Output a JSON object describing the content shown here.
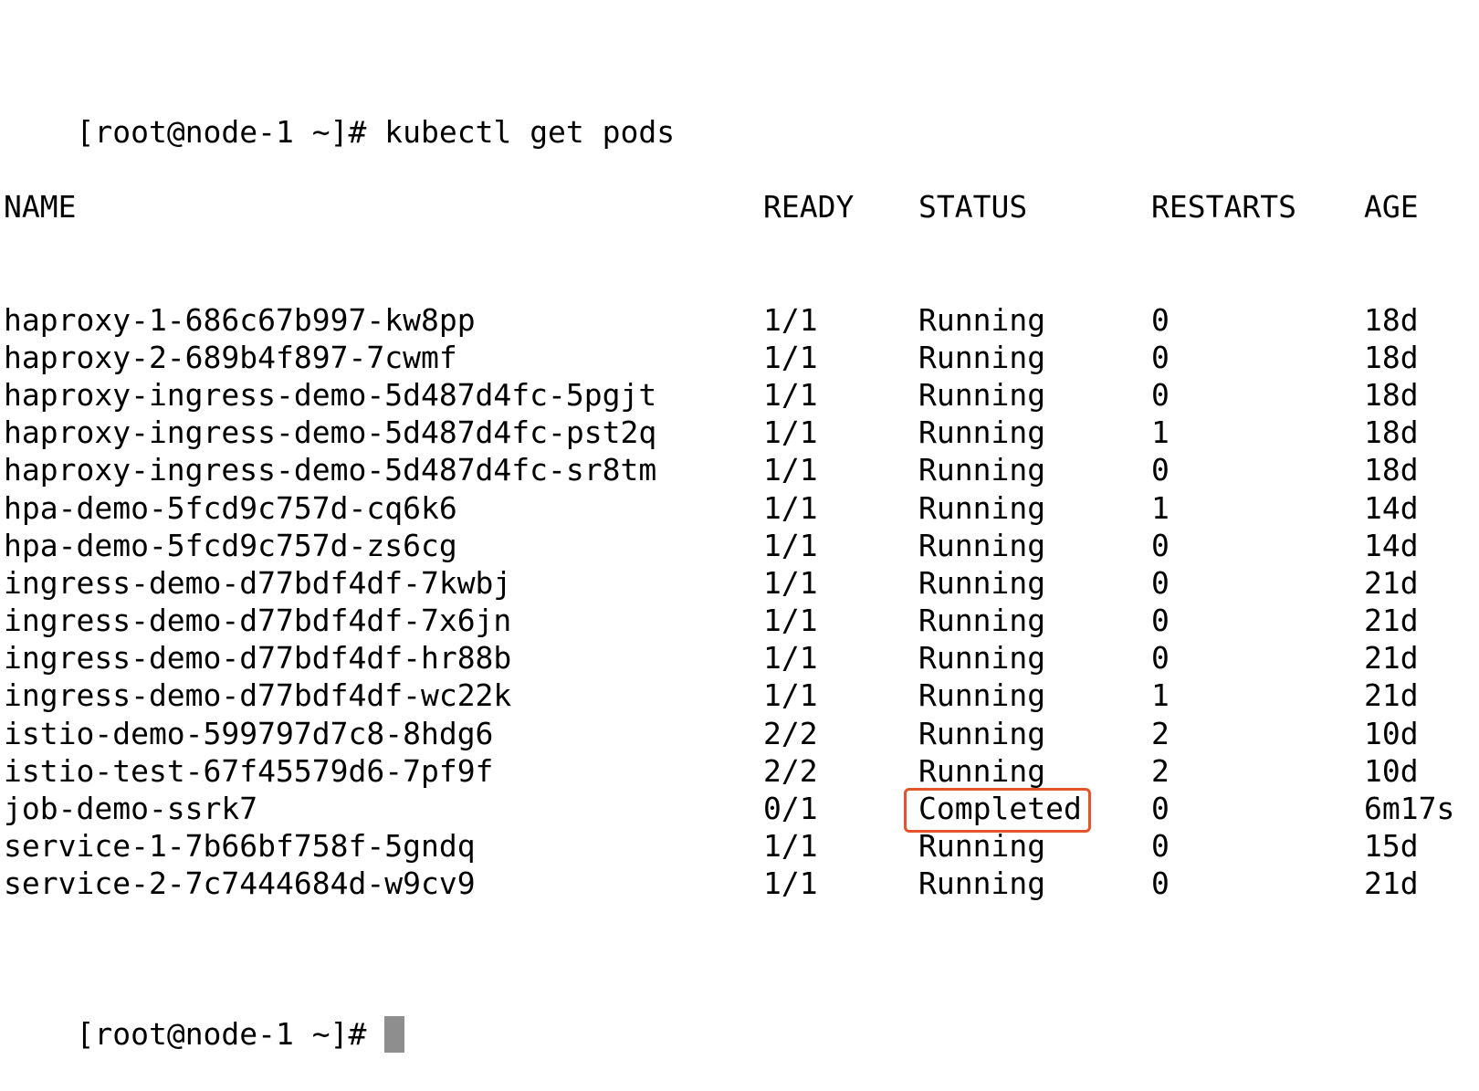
{
  "prompt": "[root@node-1 ~]# ",
  "command": "kubectl get pods",
  "headers": {
    "name": "NAME",
    "ready": "READY",
    "status": "STATUS",
    "restarts": "RESTARTS",
    "age": "AGE"
  },
  "rows": [
    {
      "name": "haproxy-1-686c67b997-kw8pp",
      "ready": "1/1",
      "status": "Running",
      "restarts": "0",
      "age": "18d"
    },
    {
      "name": "haproxy-2-689b4f897-7cwmf",
      "ready": "1/1",
      "status": "Running",
      "restarts": "0",
      "age": "18d"
    },
    {
      "name": "haproxy-ingress-demo-5d487d4fc-5pgjt",
      "ready": "1/1",
      "status": "Running",
      "restarts": "0",
      "age": "18d"
    },
    {
      "name": "haproxy-ingress-demo-5d487d4fc-pst2q",
      "ready": "1/1",
      "status": "Running",
      "restarts": "1",
      "age": "18d"
    },
    {
      "name": "haproxy-ingress-demo-5d487d4fc-sr8tm",
      "ready": "1/1",
      "status": "Running",
      "restarts": "0",
      "age": "18d"
    },
    {
      "name": "hpa-demo-5fcd9c757d-cq6k6",
      "ready": "1/1",
      "status": "Running",
      "restarts": "1",
      "age": "14d"
    },
    {
      "name": "hpa-demo-5fcd9c757d-zs6cg",
      "ready": "1/1",
      "status": "Running",
      "restarts": "0",
      "age": "14d"
    },
    {
      "name": "ingress-demo-d77bdf4df-7kwbj",
      "ready": "1/1",
      "status": "Running",
      "restarts": "0",
      "age": "21d"
    },
    {
      "name": "ingress-demo-d77bdf4df-7x6jn",
      "ready": "1/1",
      "status": "Running",
      "restarts": "0",
      "age": "21d"
    },
    {
      "name": "ingress-demo-d77bdf4df-hr88b",
      "ready": "1/1",
      "status": "Running",
      "restarts": "0",
      "age": "21d"
    },
    {
      "name": "ingress-demo-d77bdf4df-wc22k",
      "ready": "1/1",
      "status": "Running",
      "restarts": "1",
      "age": "21d"
    },
    {
      "name": "istio-demo-599797d7c8-8hdg6",
      "ready": "2/2",
      "status": "Running",
      "restarts": "2",
      "age": "10d"
    },
    {
      "name": "istio-test-67f45579d6-7pf9f",
      "ready": "2/2",
      "status": "Running",
      "restarts": "2",
      "age": "10d"
    },
    {
      "name": "job-demo-ssrk7",
      "ready": "0/1",
      "status": "Completed",
      "restarts": "0",
      "age": "6m17s",
      "highlighted": true
    },
    {
      "name": "service-1-7b66bf758f-5gndq",
      "ready": "1/1",
      "status": "Running",
      "restarts": "0",
      "age": "15d"
    },
    {
      "name": "service-2-7c7444684d-w9cv9",
      "ready": "1/1",
      "status": "Running",
      "restarts": "0",
      "age": "21d"
    }
  ],
  "colors": {
    "highlight": "#e4542c",
    "cursor": "#8e8e8e"
  }
}
